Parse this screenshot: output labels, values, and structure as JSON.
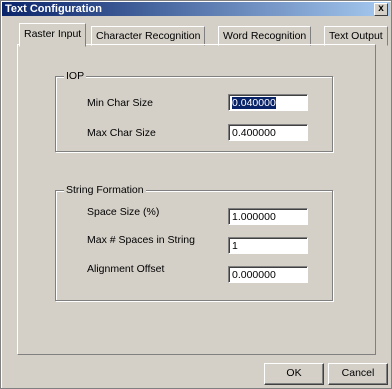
{
  "window": {
    "title": "Text Configuration",
    "close_label": "x"
  },
  "tabs": [
    {
      "label": "Raster Input",
      "active": true
    },
    {
      "label": "Character Recognition",
      "active": false
    },
    {
      "label": "Word Recognition",
      "active": false
    },
    {
      "label": "Text Output",
      "active": false
    }
  ],
  "iop": {
    "legend": "IOP",
    "min_char_size_label": "Min Char Size",
    "min_char_size_value": "0.040000",
    "max_char_size_label": "Max Char Size",
    "max_char_size_value": "0.400000"
  },
  "string_formation": {
    "legend": "String Formation",
    "space_size_label": "Space Size (%)",
    "space_size_value": "1.000000",
    "max_spaces_label": "Max # Spaces in String",
    "max_spaces_value": "1",
    "alignment_offset_label": "Alignment Offset",
    "alignment_offset_value": "0.000000"
  },
  "buttons": {
    "ok": "OK",
    "cancel": "Cancel"
  }
}
